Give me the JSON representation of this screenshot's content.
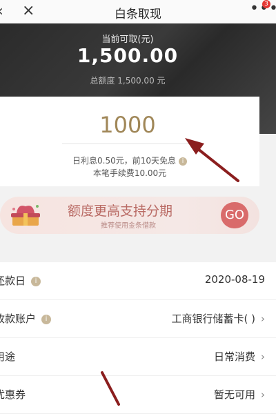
{
  "nav": {
    "back_icon": "‹",
    "close_icon": "×",
    "title": "白条取现",
    "more_icon": "•••",
    "badge": "3"
  },
  "hero": {
    "available_label": "当前可取(元)",
    "available_amount": "1,500.00",
    "total_limit": "总额度 1,500.00 元"
  },
  "form": {
    "amount_value": "1000",
    "interest_text": "日利息0.50元，前10天免息",
    "fee_text": "本笔手续费10.00元"
  },
  "banner": {
    "title": "额度更高支持分期",
    "subtitle": "推荐使用金条借款",
    "go_label": "GO"
  },
  "details": [
    {
      "label": "还款日",
      "value": "2020-08-19",
      "has_info": true,
      "has_chevron": false
    },
    {
      "label": "收款账户",
      "value": "工商银行储蓄卡(     )",
      "has_info": true,
      "has_chevron": true
    },
    {
      "label": "用途",
      "value": "日常消费",
      "has_info": false,
      "has_chevron": true
    },
    {
      "label": "优惠券",
      "value": "暂无可用",
      "has_info": false,
      "has_chevron": true
    }
  ],
  "colors": {
    "amount_gold": "#a08758",
    "banner_red": "#d96b6b",
    "annotation_arrow": "#8b1e1e"
  }
}
